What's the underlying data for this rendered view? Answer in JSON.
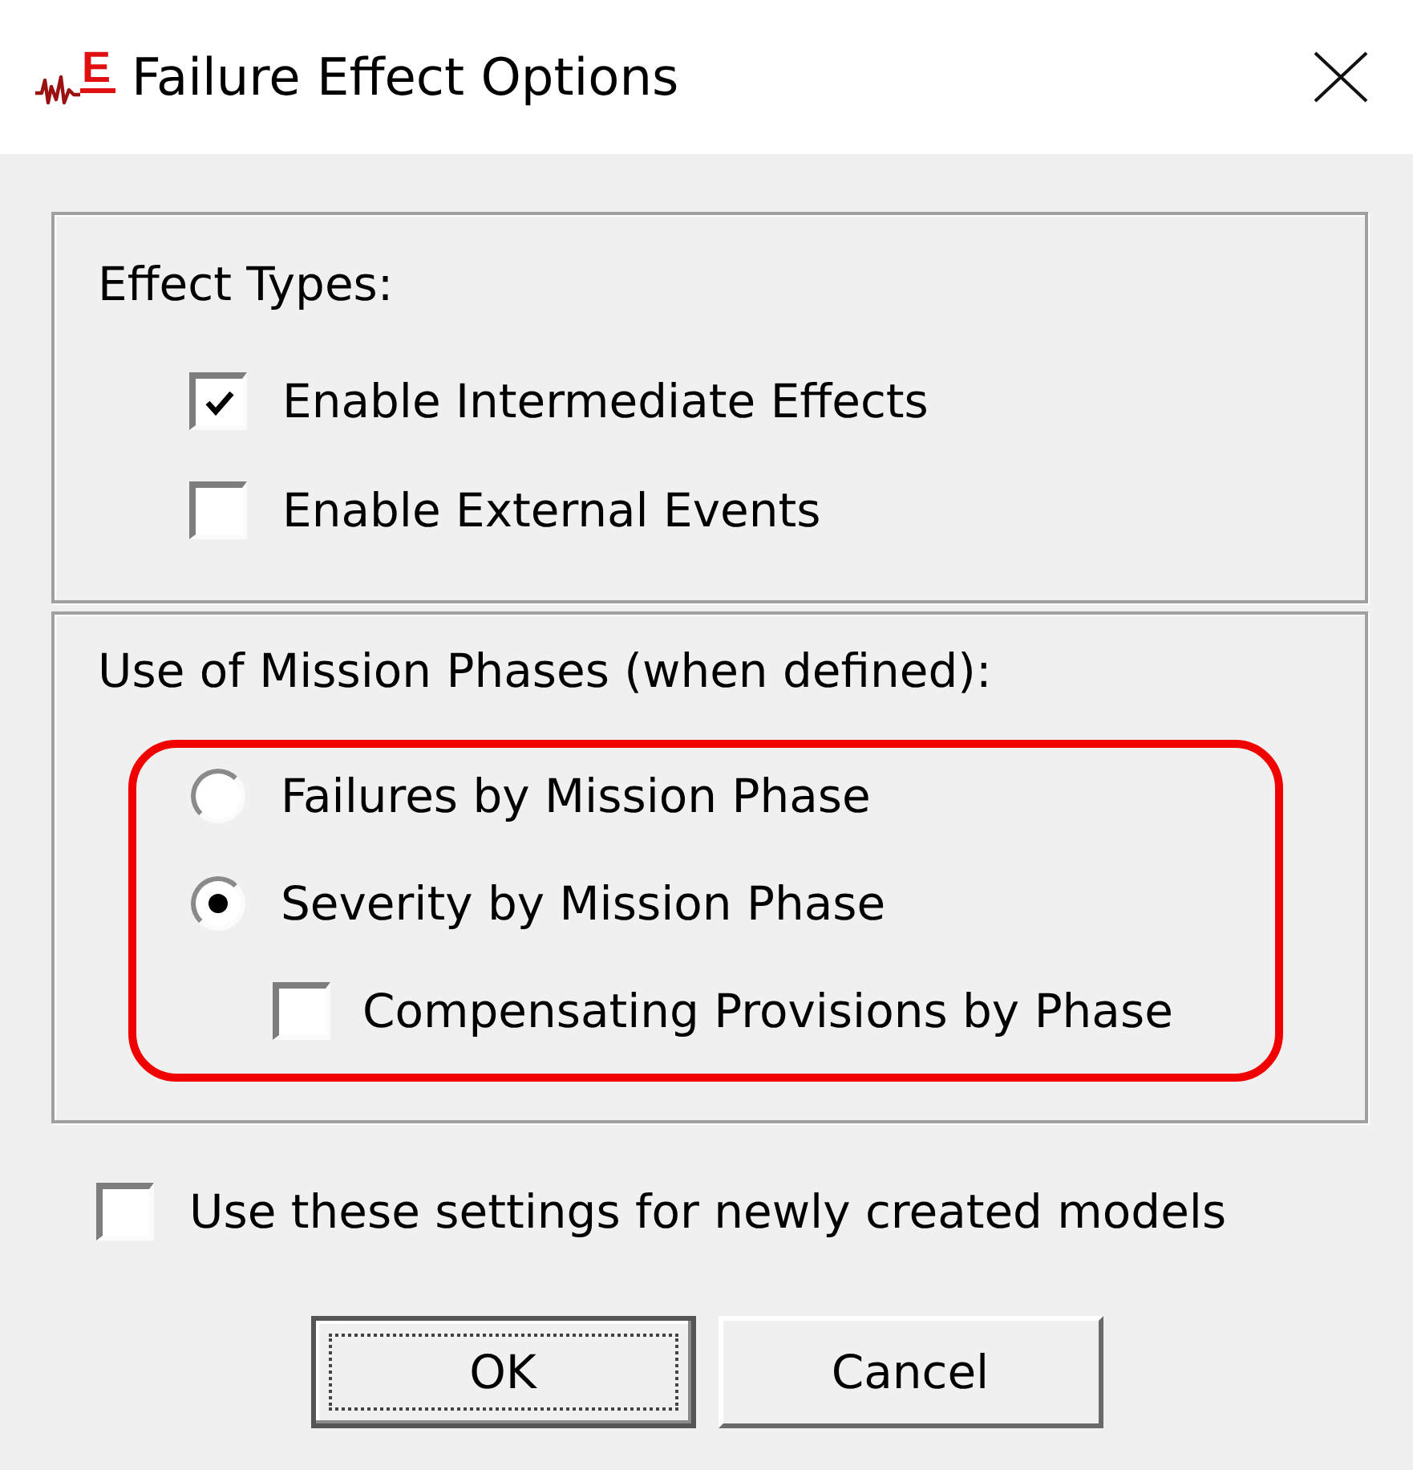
{
  "window": {
    "logo_text": "E",
    "title": "Failure Effect Options"
  },
  "effect_types": {
    "label": "Effect Types:",
    "options": [
      {
        "label": "Enable Intermediate Effects",
        "checked": true
      },
      {
        "label": "Enable External Events",
        "checked": false
      }
    ]
  },
  "mission_phases": {
    "label": "Use of Mission Phases (when defined):",
    "highlighted": true,
    "options": [
      {
        "kind": "radio",
        "label": "Failures by Mission Phase",
        "selected": false
      },
      {
        "kind": "radio",
        "label": "Severity by Mission Phase",
        "selected": true,
        "children": [
          {
            "kind": "checkbox",
            "label": "Compensating Provisions by Phase",
            "checked": false
          }
        ]
      }
    ]
  },
  "default_setting": {
    "label": "Use these settings for newly created models",
    "checked": false
  },
  "buttons": [
    {
      "label": "OK",
      "default": true
    },
    {
      "label": "Cancel",
      "default": false
    }
  ]
}
